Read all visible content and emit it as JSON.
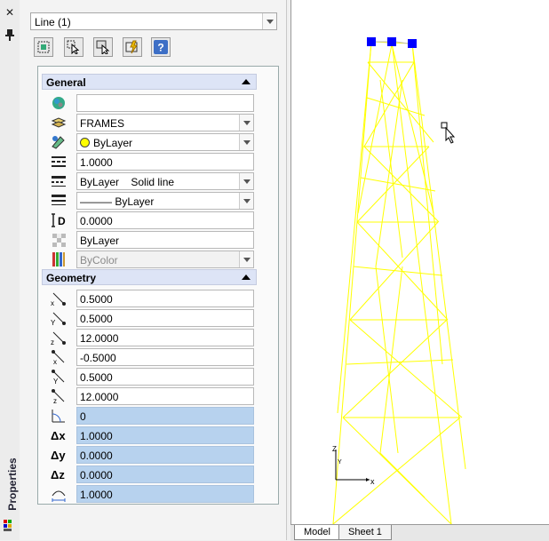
{
  "palette": {
    "title": "Properties",
    "selection": "Line (1)",
    "toolbar": [
      "quick-select-icon",
      "select-objects-icon",
      "toggle-pickadd-icon",
      "quick-properties-icon",
      "help-icon"
    ],
    "general": {
      "title": "General",
      "color": "",
      "layer": "FRAMES",
      "linetype_color": "ByLayer",
      "linetype_scale": "1.0000",
      "plot_style": "ByLayer",
      "plot_style_sub": "Solid line",
      "lineweight": "——— ByLayer",
      "thickness": "0.0000",
      "transparency": "ByLayer",
      "hyperlink": "ByColor",
      "thickness_label": "D"
    },
    "geometry": {
      "title": "Geometry",
      "start_x": "0.5000",
      "start_y": "0.5000",
      "start_z": "12.0000",
      "end_x": "-0.5000",
      "end_y": "0.5000",
      "end_z": "12.0000",
      "angle": "0",
      "delta_x": "1.0000",
      "delta_y": "0.0000",
      "delta_z": "0.0000",
      "length": "1.0000",
      "delta_x_label": "Δx",
      "delta_y_label": "Δy",
      "delta_z_label": "Δz"
    }
  },
  "viewport": {
    "ucs_x": "x",
    "ucs_y": "Y",
    "ucs_z": "Z",
    "line_color": "#ffff00",
    "grip_color": "#0000ff"
  },
  "tabs": {
    "model": "Model",
    "sheet1": "Sheet 1"
  }
}
